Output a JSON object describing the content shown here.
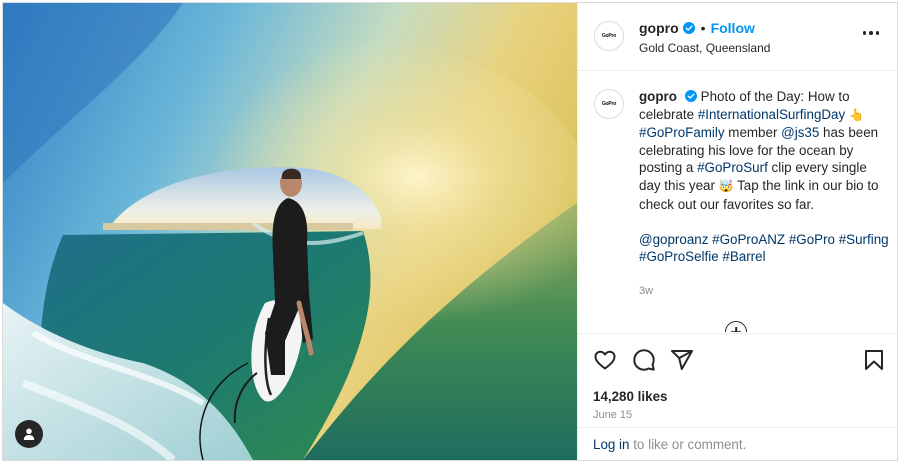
{
  "account": {
    "username": "gopro",
    "avatar_logo": "GoPro",
    "follow_label": "Follow",
    "separator": "•",
    "location": "Gold Coast, Queensland"
  },
  "caption": {
    "username": "gopro",
    "t1": "Photo of the Day: How to celebrate ",
    "tag_intl": "#InternationalSurfingDay",
    "emoji_hand": "👆",
    "tag_family": "#GoProFamily",
    "t2": " member ",
    "mention_js35": "@js35",
    "t3": " has been celebrating his love for the ocean by posting a ",
    "tag_surf": "#GoProSurf",
    "t4": " clip every single day this year ",
    "emoji_face": "🤯",
    "t5": " Tap the link in our bio to check out our favorites so far.",
    "mention_anz": "@goproanz",
    "tag_anz": "#GoProANZ",
    "tag_gopro": "#GoPro",
    "tag_surfing": "#Surfing",
    "tag_selfie": "#GoProSelfie",
    "tag_barrel": "#Barrel",
    "time_ago": "3w"
  },
  "actions": {
    "like_icon": "heart-icon",
    "comment_icon": "comment-icon",
    "share_icon": "paper-plane-icon",
    "save_icon": "bookmark-icon"
  },
  "likes_text": "14,280 likes",
  "date_text": "June 15",
  "login": {
    "link": "Log in",
    "rest": " to like or comment."
  },
  "colors": {
    "link_blue": "#0095f6",
    "hashtag": "#00376b",
    "muted": "#8e8e8e",
    "text": "#262626"
  }
}
